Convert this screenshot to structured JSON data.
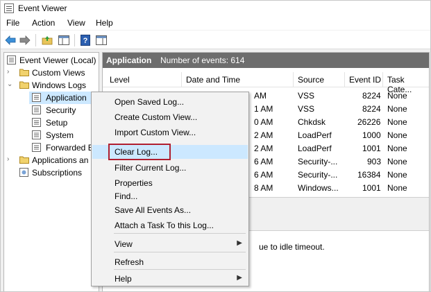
{
  "window": {
    "title": "Event Viewer"
  },
  "menu": [
    "File",
    "Action",
    "View",
    "Help"
  ],
  "toolbar": {
    "buttons": [
      "back-arrow-icon",
      "forward-arrow-icon",
      "folder-up-icon",
      "show-hide-tree-icon",
      "help-icon",
      "show-action-pane-icon"
    ]
  },
  "tree": {
    "root": "Event Viewer (Local)",
    "custom_views": "Custom Views",
    "windows_logs": "Windows Logs",
    "application": "Application",
    "security": "Security",
    "setup": "Setup",
    "system": "System",
    "forwarded": "Forwarded E",
    "apps_services": "Applications an",
    "subscriptions": "Subscriptions"
  },
  "pane": {
    "title": "Application",
    "count": "Number of events: 614"
  },
  "table": {
    "headers": [
      "Level",
      "Date and Time",
      "Source",
      "Event ID",
      "Task Cate..."
    ],
    "rows": [
      {
        "time": "AM",
        "source": "VSS",
        "id": "8224",
        "task": "None"
      },
      {
        "time": "1 AM",
        "source": "VSS",
        "id": "8224",
        "task": "None"
      },
      {
        "time": "0 AM",
        "source": "Chkdsk",
        "id": "26226",
        "task": "None"
      },
      {
        "time": "2 AM",
        "source": "LoadPerf",
        "id": "1000",
        "task": "None"
      },
      {
        "time": "2 AM",
        "source": "LoadPerf",
        "id": "1001",
        "task": "None"
      },
      {
        "time": "6 AM",
        "source": "Security-...",
        "id": "903",
        "task": "None"
      },
      {
        "time": "6 AM",
        "source": "Security-...",
        "id": "16384",
        "task": "None"
      },
      {
        "time": "8 AM",
        "source": "Windows...",
        "id": "1001",
        "task": "None"
      }
    ]
  },
  "details": {
    "text": "ue to idle timeout."
  },
  "context_menu": {
    "items": [
      {
        "label": "Open Saved Log..."
      },
      {
        "label": "Create Custom View..."
      },
      {
        "label": "Import Custom View..."
      },
      {
        "label": "Clear Log..."
      },
      {
        "label": "Filter Current Log..."
      },
      {
        "label": "Properties"
      },
      {
        "label": "Find..."
      },
      {
        "label": "Save All Events As..."
      },
      {
        "label": "Attach a Task To this Log..."
      },
      {
        "label": "View"
      },
      {
        "label": "Refresh"
      },
      {
        "label": "Help"
      }
    ],
    "highlighted": "Clear Log..."
  },
  "colors": {
    "header_bg": "#6d6d6d",
    "highlight": "#cce8ff",
    "callout": "#b01e2f",
    "selection": "#cce8ff"
  }
}
